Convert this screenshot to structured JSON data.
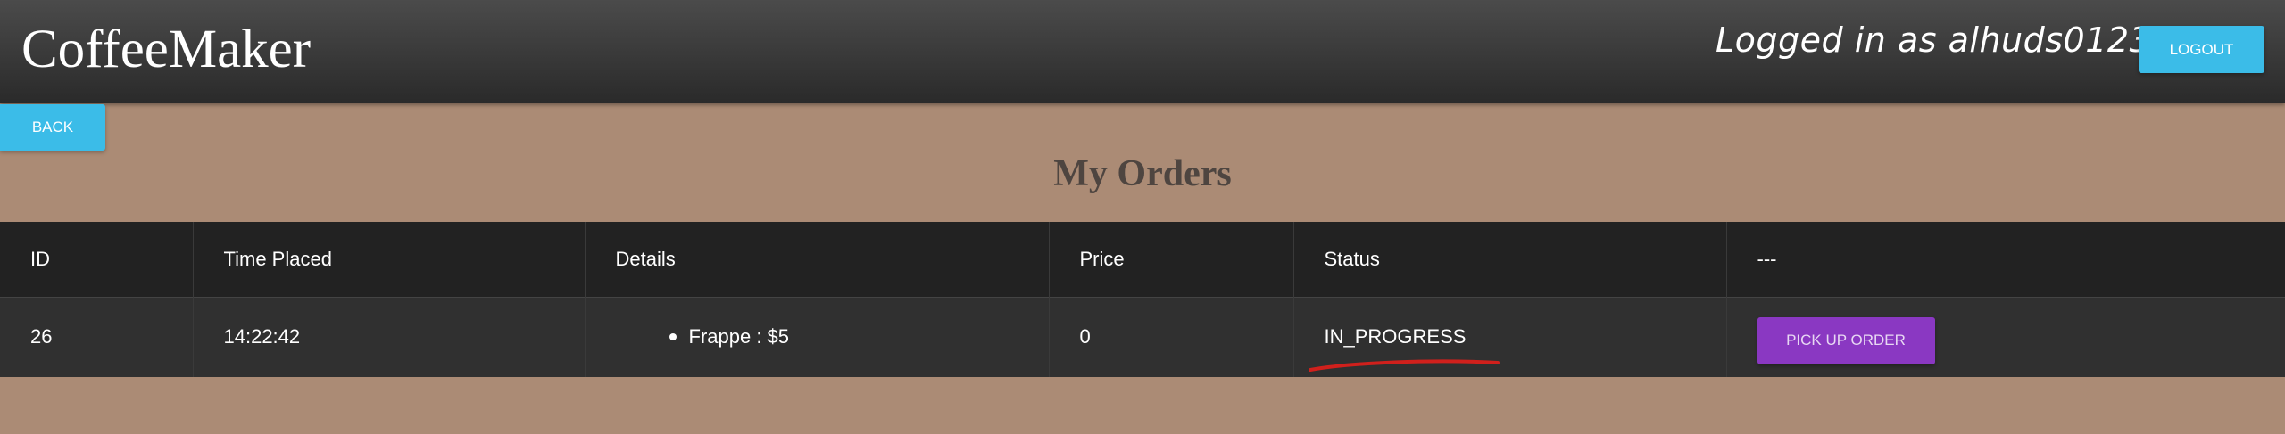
{
  "header": {
    "brand": "CoffeeMaker",
    "logged_in_text": "Logged in as alhuds0123",
    "logout_label": "LOGOUT"
  },
  "nav": {
    "back_label": "BACK"
  },
  "main": {
    "title": "My Orders",
    "table": {
      "columns": [
        "ID",
        "Time Placed",
        "Details",
        "Price",
        "Status",
        "---"
      ],
      "rows": [
        {
          "id": "26",
          "time_placed": "14:22:42",
          "details": [
            "Frappe : $5"
          ],
          "price": "0",
          "status": "IN_PROGRESS",
          "action_label": "PICK UP ORDER"
        }
      ]
    }
  },
  "colors": {
    "background": "#ab8b75",
    "header": "#333333",
    "accent_button": "#3bbce8",
    "pickup_button": "#8a38c2",
    "annotation_underline": "#d0201c"
  }
}
